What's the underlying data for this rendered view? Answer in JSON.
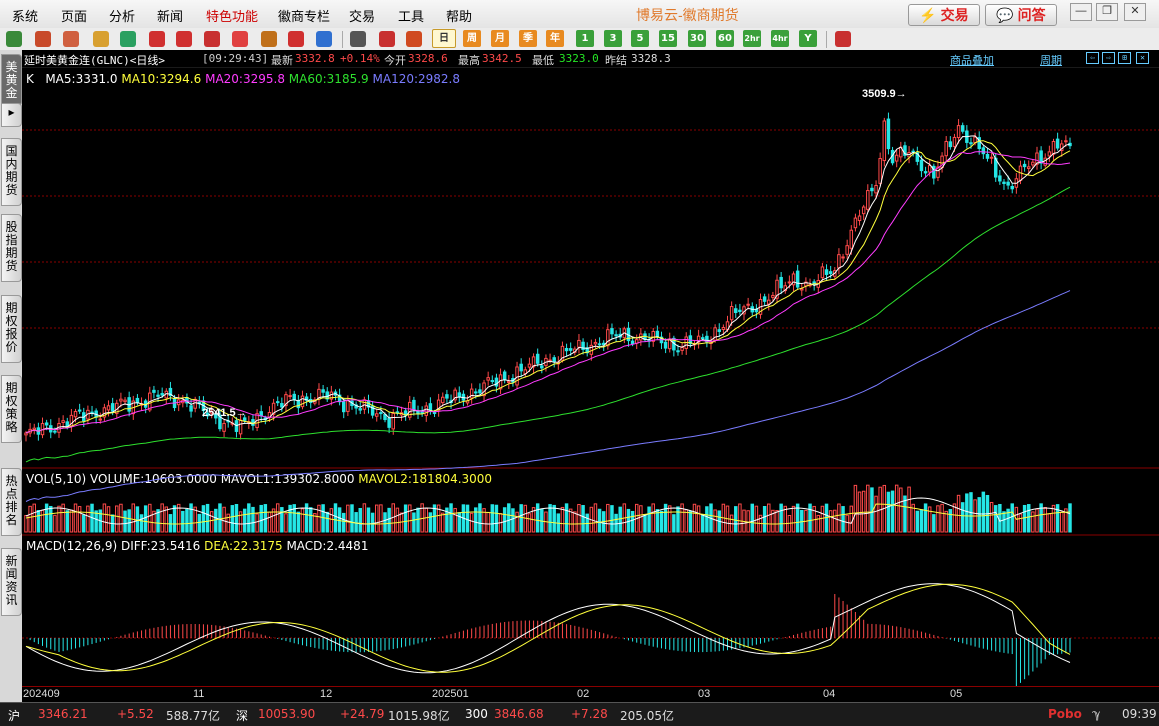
{
  "menu": {
    "items": [
      "系统",
      "页面",
      "分析",
      "新闻",
      "特色功能",
      "徽商专栏",
      "交易",
      "工具",
      "帮助"
    ],
    "app_title": "博易云-徽商期货",
    "trade_btn": "交易",
    "ask_btn": "问答"
  },
  "toolbar": {
    "periods": [
      "日",
      "周",
      "月",
      "季",
      "年",
      "1",
      "3",
      "5",
      "15",
      "30",
      "60",
      "2hr",
      "4hr",
      "Y"
    ],
    "current_period": "日"
  },
  "left_tabs": [
    "美黄金",
    "国内期货",
    "股指期货",
    "期权报价",
    "期权策略",
    "热点排名",
    "新闻资讯"
  ],
  "infobar": {
    "symbol": "延时美黄金连(GLNC)<日线>",
    "time": "[09:29:43]",
    "latest_label": "最新",
    "latest": "3332.8",
    "change_pct": "+0.14%",
    "open_label": "今开",
    "open": "3328.6",
    "high_label": "最高",
    "high": "3342.5",
    "low_label": "最低",
    "low": "3323.0",
    "prev_label": "昨结",
    "prev": "3328.3",
    "overlay_link": "商品叠加",
    "period_link": "周期"
  },
  "kline_legend": {
    "k": "K",
    "ma5": "MA5:3331.0",
    "ma10": "MA10:3294.6",
    "ma20": "MA20:3295.8",
    "ma60": "MA60:3185.9",
    "ma120": "MA120:2982.8"
  },
  "volume_legend": {
    "name": "VOL(5,10)",
    "volume": "VOLUME:10603.0000",
    "mavol1": "MAVOL1:139302.8000",
    "mavol2": "MAVOL2:181804.3000"
  },
  "macd_legend": {
    "name": "MACD(12,26,9)",
    "diff": "DIFF:23.5416",
    "dea": "DEA:22.3175",
    "macd": "MACD:2.4481"
  },
  "annotations": {
    "high_mark": "3509.9",
    "low_mark": "2541.5"
  },
  "x_labels": [
    "202409",
    "11",
    "12",
    "202501",
    "02",
    "03",
    "04",
    "05"
  ],
  "statusbar": {
    "sh_label": "沪",
    "sh_value": "3346.21",
    "sh_change": "+5.52",
    "sh_amount": "588.77亿",
    "sz_label": "深",
    "sz_value": "10053.90",
    "sz_change": "+24.79",
    "sz_amount": "1015.98亿",
    "i300_label": "300",
    "i300_value": "3846.68",
    "i300_change": "+7.28",
    "i300_amount": "205.05亿",
    "brand": "Pobo",
    "clock": "09:39"
  },
  "colors": {
    "up": "#ff4a4a",
    "down": "#25e6e6",
    "ma5": "#ffffff",
    "ma10": "#ffff3c",
    "ma20": "#ff3cff",
    "ma60": "#2ee02e",
    "ma120": "#7a7cff",
    "grid": "#8a0000"
  },
  "chart_data": {
    "type": "candlestick",
    "symbol": "GLNC",
    "period": "日",
    "annotations": [
      {
        "label": "3509.9",
        "value": 3509.9
      },
      {
        "label": "2541.5",
        "value": 2541.5
      }
    ],
    "x_ticks": [
      "202409",
      "11",
      "12",
      "202501",
      "02",
      "03",
      "04",
      "05"
    ],
    "last": {
      "close": 3332.8,
      "open": 3328.6,
      "high": 3342.5,
      "low": 3323.0
    },
    "ma_last": {
      "ma5": 3331.0,
      "ma10": 3294.6,
      "ma20": 3295.8,
      "ma60": 3185.9,
      "ma120": 2982.8
    },
    "volume_last": 10603.0,
    "mavol1": 139302.8,
    "mavol2": 181804.3,
    "macd_last": {
      "diff": 23.5416,
      "dea": 22.3175,
      "macd": 2.4481
    }
  }
}
